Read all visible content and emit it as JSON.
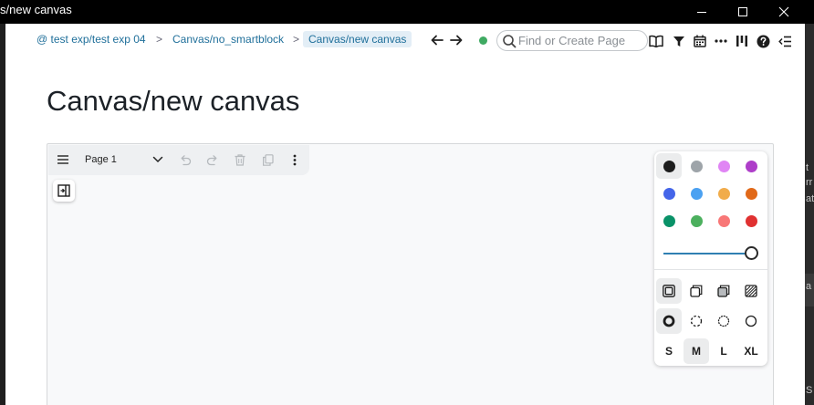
{
  "window": {
    "title": "s/new canvas"
  },
  "breadcrumbs": [
    {
      "label": "@ test exp/test exp 04"
    },
    {
      "label": "Canvas/no_smartblock"
    },
    {
      "label": "Canvas/new canvas",
      "active": true
    }
  ],
  "breadcrumb_separator": ">",
  "search": {
    "placeholder": "Find or Create Page",
    "value": ""
  },
  "status": {
    "sync_color": "#3faa62"
  },
  "toolbar_icons": [
    "book-icon",
    "filter-icon",
    "calendar-icon",
    "more-icon",
    "columns-icon",
    "help-icon",
    "sidebar-toggle-icon"
  ],
  "page": {
    "title": "Canvas/new canvas"
  },
  "canvas": {
    "page_menu": {
      "current_page": "Page 1"
    },
    "style_panel": {
      "colors": [
        "#1d1d1d",
        "#9ea4a9",
        "#e085f4",
        "#ae3ec9",
        "#4465e9",
        "#4ba1f1",
        "#f1ac4b",
        "#e16919",
        "#099268",
        "#4cb05e",
        "#f87777",
        "#e03131"
      ],
      "selected_color_index": 0,
      "opacity": 1.0,
      "fill_options": [
        "fill-none",
        "fill-semi",
        "fill-solid",
        "fill-pattern"
      ],
      "selected_fill_index": 0,
      "dash_options": [
        "dash-draw",
        "dash-dashed",
        "dash-dotted",
        "dash-solid"
      ],
      "selected_dash_index": 0,
      "sizes": [
        "S",
        "M",
        "L",
        "XL"
      ],
      "selected_size_index": 1
    }
  },
  "background_window_text": {
    "fragments": [
      "t",
      "rr",
      "at",
      "a",
      "S"
    ]
  }
}
